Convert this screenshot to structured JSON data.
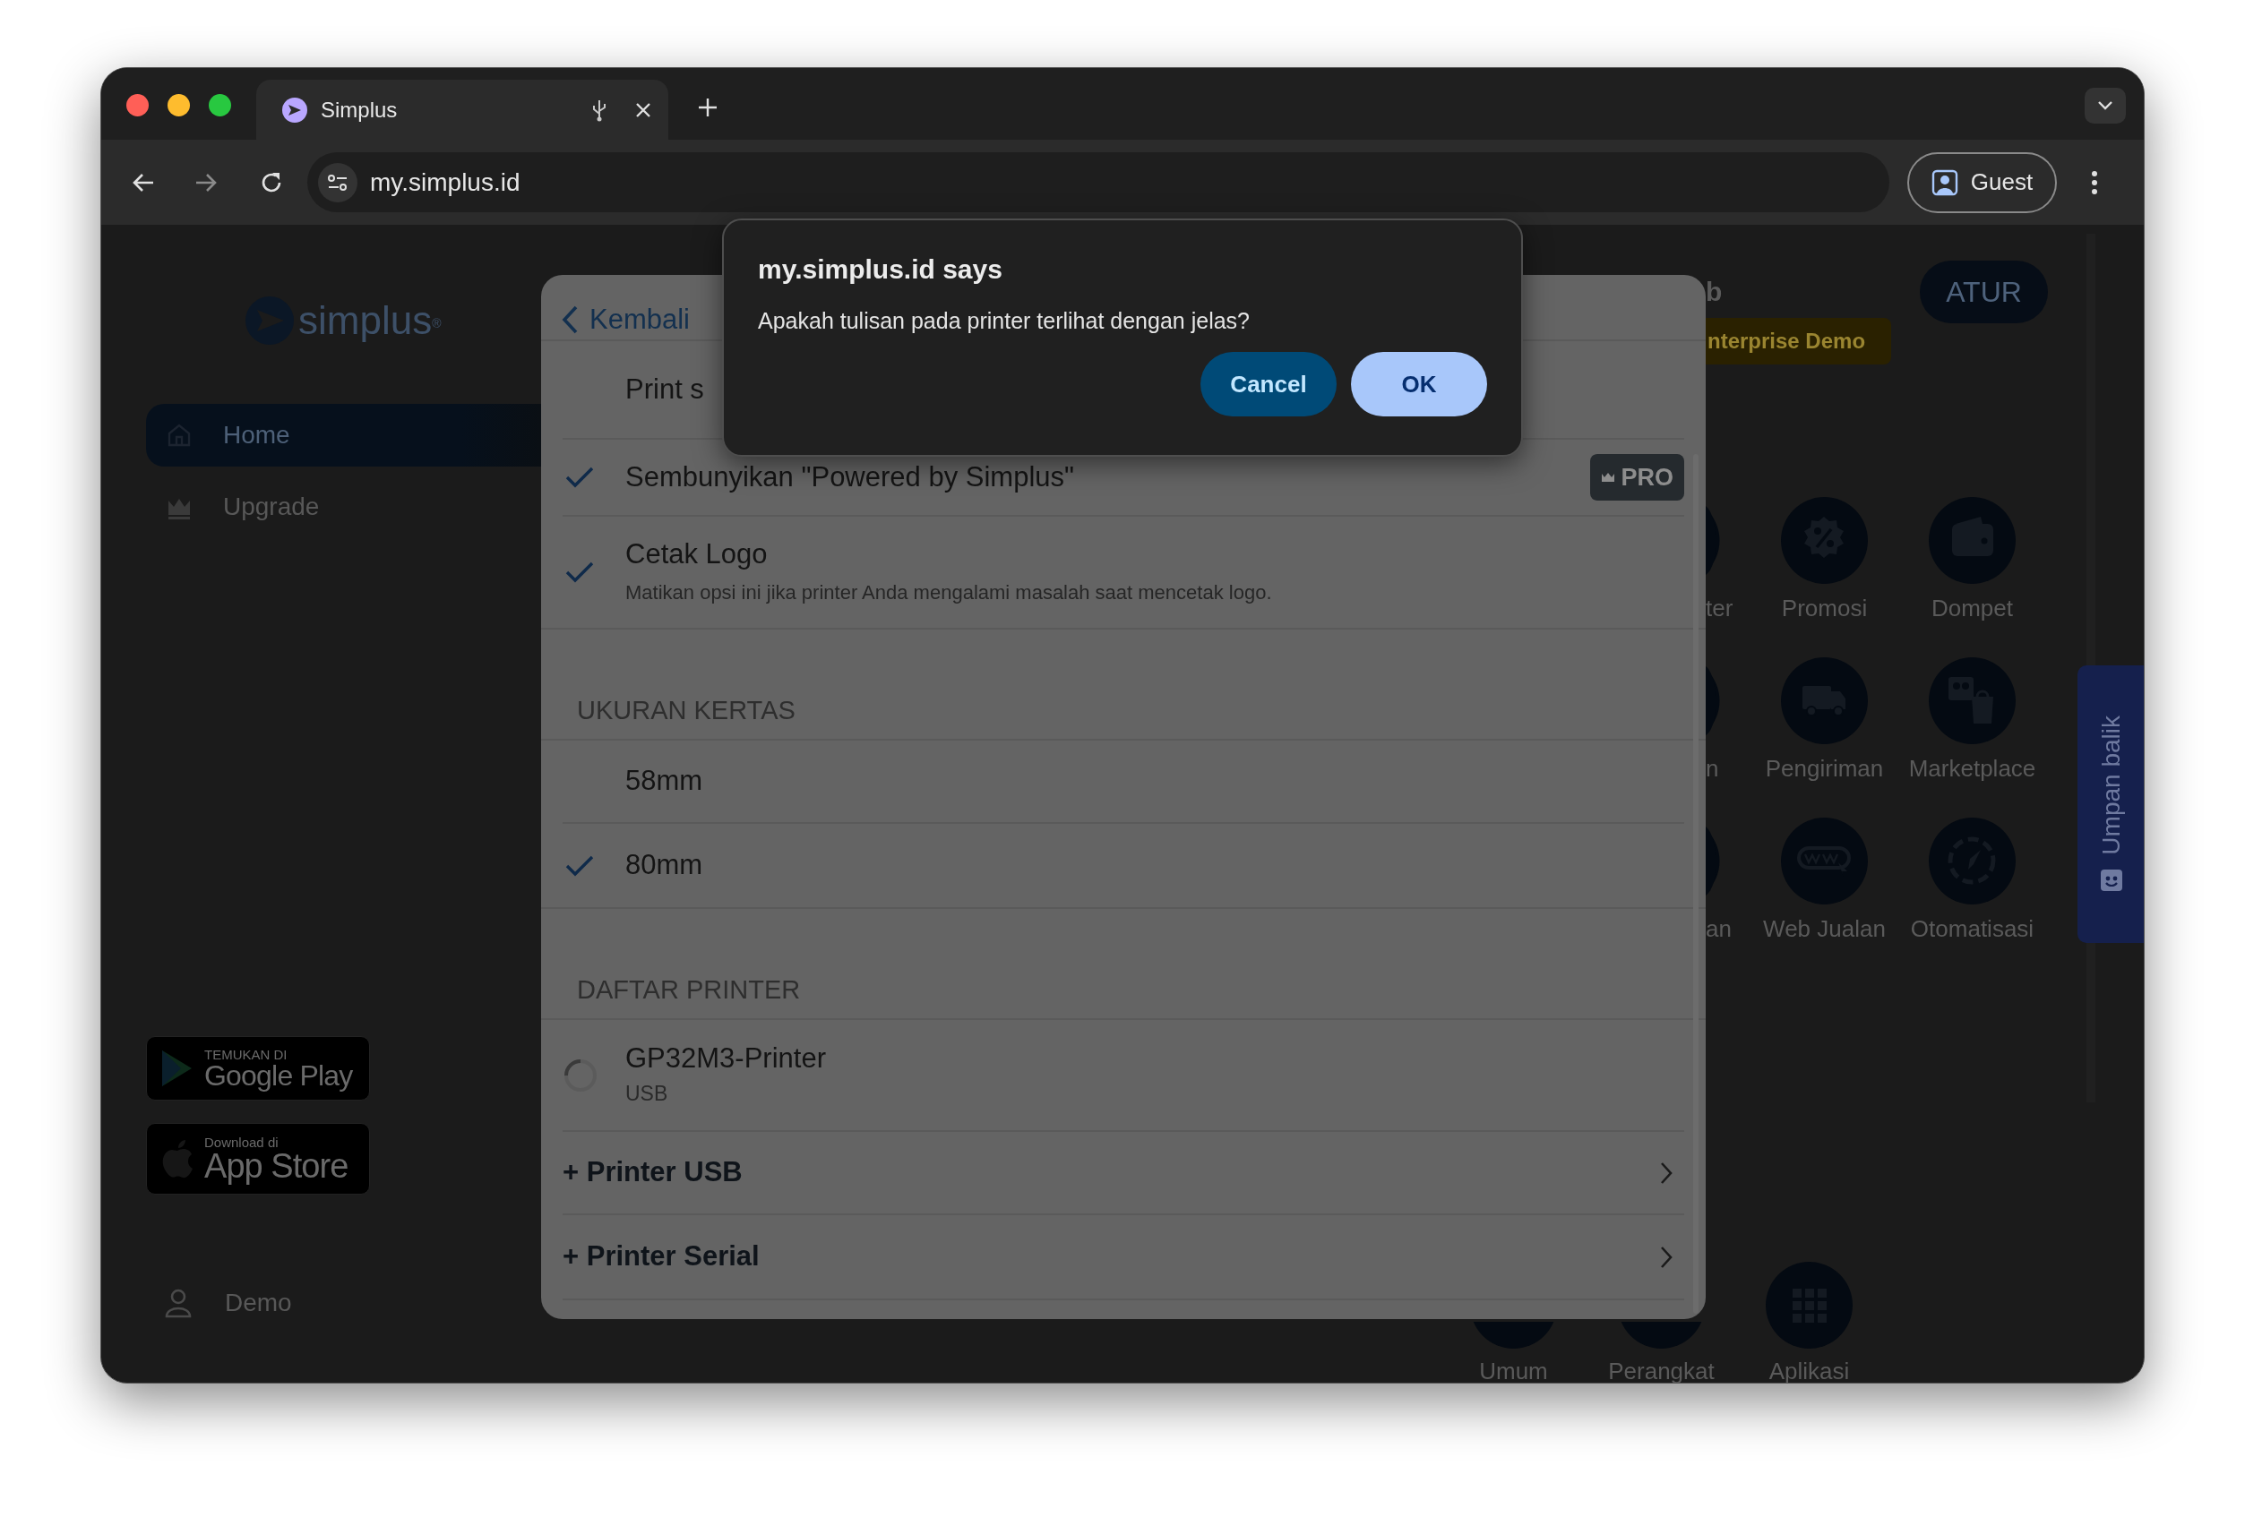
{
  "browser": {
    "tab": {
      "title": "Simplus",
      "selected": true
    },
    "address": "my.simplus.id",
    "profile": "Guest"
  },
  "sidebar": {
    "logo": "simplus",
    "logo_mark": "®",
    "items": [
      {
        "label": "Home",
        "selected": true
      },
      {
        "label": "Upgrade",
        "selected": false
      }
    ],
    "store_badges": [
      {
        "kind": "google",
        "caption": "TEMUKAN DI",
        "name": "Google Play"
      },
      {
        "kind": "apple",
        "caption": "Download di",
        "name": "App Store"
      }
    ],
    "user": "Demo"
  },
  "header": {
    "title": "b",
    "plan": "nterprise Demo",
    "action": "ATUR"
  },
  "app_rows": [
    [
      "ter",
      "Promosi",
      "Dompet"
    ],
    [
      "n",
      "Pengiriman",
      "Marketplace"
    ],
    [
      "an",
      "Web Jualan",
      "Otomatisasi"
    ]
  ],
  "bottom_apps": [
    "Umum",
    "Perangkat",
    "Aplikasi"
  ],
  "feedback": "Umpan balik",
  "settings_panel": {
    "back": "Kembali",
    "sections": [
      {
        "items": [
          {
            "kind": "option",
            "label": "Print s",
            "checked": false
          },
          {
            "kind": "option",
            "label": "Sembunyikan \"Powered by Simplus\"",
            "checked": true,
            "badge": "PRO"
          },
          {
            "kind": "option",
            "label": "Cetak Logo",
            "description": "Matikan opsi ini jika printer Anda mengalami masalah saat mencetak logo.",
            "checked": true
          }
        ]
      },
      {
        "heading": "UKURAN KERTAS",
        "items": [
          {
            "kind": "option",
            "label": "58mm",
            "selected": false
          },
          {
            "kind": "option",
            "label": "80mm",
            "selected": true
          }
        ]
      },
      {
        "heading": "DAFTAR PRINTER",
        "items": [
          {
            "kind": "printer",
            "label": "GP32M3-Printer",
            "description": "USB",
            "loading": true
          },
          {
            "kind": "link",
            "label": "+ Printer USB"
          },
          {
            "kind": "link",
            "label": "+ Printer Serial"
          }
        ]
      }
    ]
  },
  "dialog": {
    "title": "my.simplus.id says",
    "message": "Apakah tulisan pada printer terlihat dengan jelas?",
    "buttons": [
      {
        "label": "Cancel",
        "kind": "secondary"
      },
      {
        "label": "OK",
        "kind": "primary"
      }
    ]
  }
}
